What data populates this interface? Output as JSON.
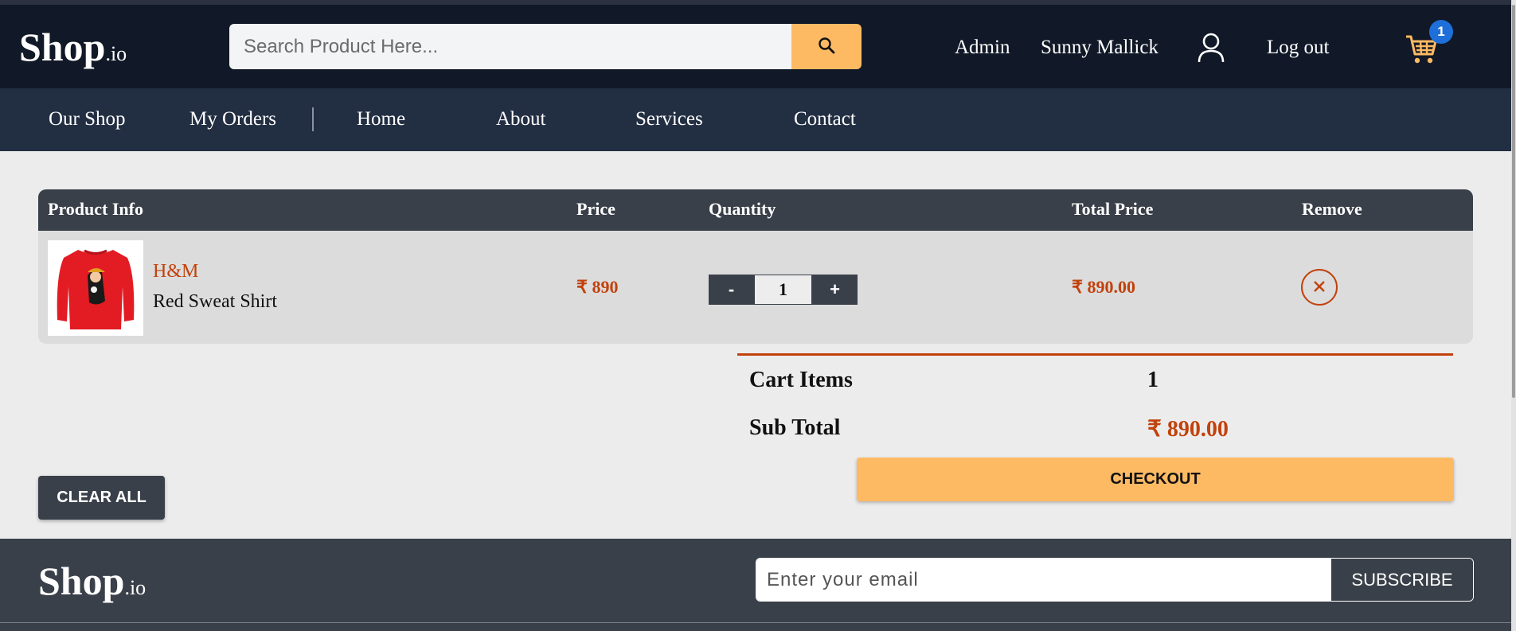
{
  "header": {
    "logo_main": "Shop",
    "logo_suffix": ".io",
    "search_placeholder": "Search Product Here...",
    "search_icon": "search-icon",
    "links": {
      "admin": "Admin",
      "user_name": "Sunny Mallick",
      "logout": "Log out"
    },
    "user_icon": "user-icon",
    "cart_icon": "cart-icon",
    "cart_count": "1"
  },
  "nav": {
    "items": [
      "Our Shop",
      "My Orders",
      "Home",
      "About",
      "Services",
      "Contact"
    ]
  },
  "cart": {
    "headers": {
      "product": "Product Info",
      "price": "Price",
      "quantity": "Quantity",
      "total": "Total Price",
      "remove": "Remove"
    },
    "items": [
      {
        "brand": "H&M",
        "name": "Red Sweat Shirt",
        "price": "₹ 890",
        "quantity": "1",
        "total": "₹ 890.00",
        "minus": "-",
        "plus": "+"
      }
    ]
  },
  "summary": {
    "items_label": "Cart Items",
    "items_value": "1",
    "subtotal_label": "Sub Total",
    "subtotal_value": "₹ 890.00",
    "checkout_label": "CHECKOUT",
    "clear_label": "CLEAR ALL"
  },
  "footer": {
    "logo_main": "Shop",
    "logo_suffix": ".io",
    "email_placeholder": "Enter your email",
    "subscribe_label": "SUBSCRIBE"
  },
  "colors": {
    "header_bg": "#111827",
    "nav_bg": "#222e42",
    "accent": "#fdba63",
    "price": "#c2410c",
    "dark": "#3a4049",
    "badge": "#1e6fd9"
  }
}
